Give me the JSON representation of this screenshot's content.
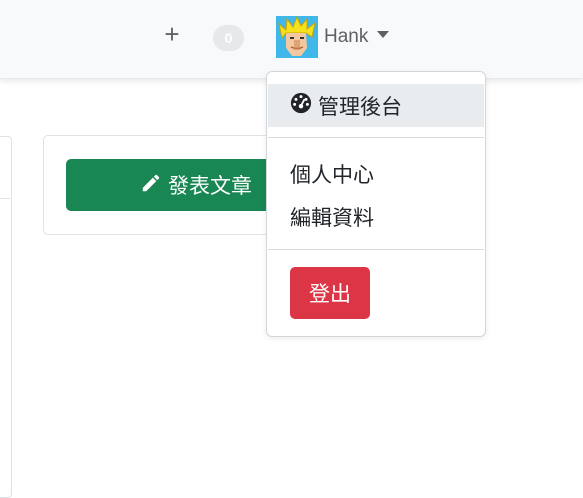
{
  "navbar": {
    "add_symbol": "+",
    "notification_count": "0",
    "username": "Hank"
  },
  "page": {
    "post_button_label": "發表文章"
  },
  "dropdown": {
    "admin_label": "管理後台",
    "profile_label": "個人中心",
    "edit_label": "編輯資料",
    "logout_label": "登出"
  },
  "colors": {
    "post_button": "#198754",
    "logout_button": "#dc3545",
    "active_item_bg": "#e9ecef"
  }
}
